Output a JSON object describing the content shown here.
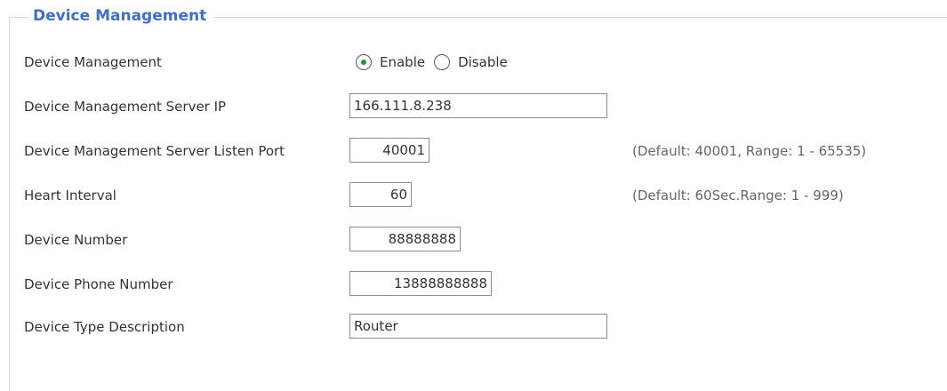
{
  "section": {
    "title": "Device Management"
  },
  "rows": {
    "device_management": {
      "label": "Device Management",
      "options": {
        "enable": "Enable",
        "disable": "Disable"
      },
      "selected": "Enable"
    },
    "server_ip": {
      "label": "Device Management Server IP",
      "value": "166.111.8.238"
    },
    "listen_port": {
      "label": "Device Management Server Listen Port",
      "value": "40001",
      "hint": "(Default: 40001, Range: 1 - 65535)"
    },
    "heart_interval": {
      "label": "Heart Interval",
      "value": "60",
      "hint": "(Default: 60Sec.Range: 1 - 999)"
    },
    "device_number": {
      "label": "Device Number",
      "value": "88888888"
    },
    "phone_number": {
      "label": "Device Phone Number",
      "value": "13888888888"
    },
    "type_description": {
      "label": "Device Type Description",
      "value": "Router"
    }
  },
  "colors": {
    "legend": "#3f6fc9",
    "radio_selected": "#1e9a3c",
    "border": "#8c8c8c"
  },
  "icons": {
    "radio_on": "radio-selected-icon",
    "radio_off": "radio-unselected-icon"
  }
}
